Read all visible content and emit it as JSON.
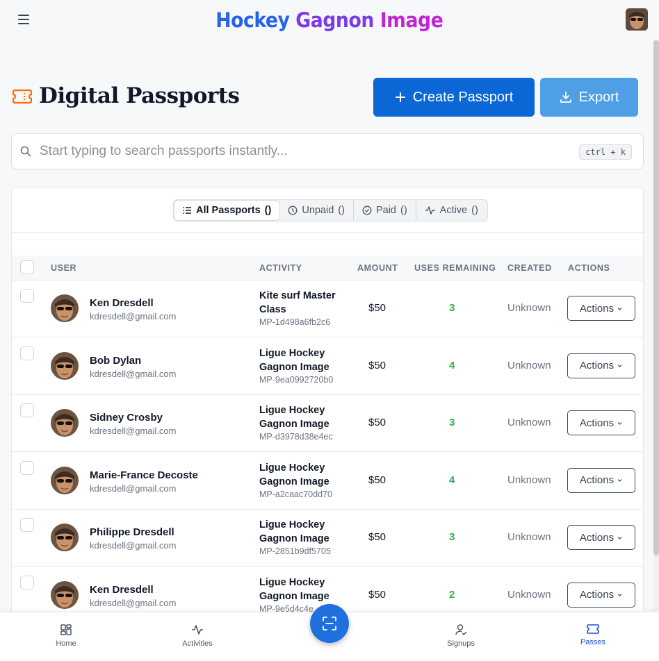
{
  "header": {
    "brand_part1": "Hockey",
    "brand_part2": "Gagnon",
    "brand_part3": "Image"
  },
  "page": {
    "title": "Digital Passports",
    "create_label": "Create Passport",
    "export_label": "Export"
  },
  "search": {
    "placeholder": "Start typing to search passports instantly...",
    "shortcut": "ctrl + k"
  },
  "tabs": [
    {
      "label": "All Passports",
      "count": "()"
    },
    {
      "label": "Unpaid",
      "count": "()"
    },
    {
      "label": "Paid",
      "count": "()"
    },
    {
      "label": "Active",
      "count": "()"
    }
  ],
  "table": {
    "columns": [
      "USER",
      "ACTIVITY",
      "AMOUNT",
      "USES REMAINING",
      "CREATED",
      "ACTIONS"
    ],
    "rows": [
      {
        "name": "Ken Dresdell",
        "email": "kdresdell@gmail.com",
        "activity": "Kite surf Master Class",
        "id": "MP-1d498a6fb2c6",
        "amount": "$50",
        "uses": "3",
        "created": "Unknown",
        "action": "Actions"
      },
      {
        "name": "Bob Dylan",
        "email": "kdresdell@gmail.com",
        "activity": "Ligue Hockey Gagnon Image",
        "id": "MP-9ea0992720b0",
        "amount": "$50",
        "uses": "4",
        "created": "Unknown",
        "action": "Actions"
      },
      {
        "name": "Sidney Crosby",
        "email": "kdresdell@gmail.com",
        "activity": "Ligue Hockey Gagnon Image",
        "id": "MP-d3978d38e4ec",
        "amount": "$50",
        "uses": "3",
        "created": "Unknown",
        "action": "Actions"
      },
      {
        "name": "Marie-France Decoste",
        "email": "kdresdell@gmail.com",
        "activity": "Ligue Hockey Gagnon Image",
        "id": "MP-a2caac70dd70",
        "amount": "$50",
        "uses": "4",
        "created": "Unknown",
        "action": "Actions"
      },
      {
        "name": "Philippe Dresdell",
        "email": "kdresdell@gmail.com",
        "activity": "Ligue Hockey Gagnon Image",
        "id": "MP-2851b9df5705",
        "amount": "$50",
        "uses": "3",
        "created": "Unknown",
        "action": "Actions"
      },
      {
        "name": "Ken Dresdell",
        "email": "kdresdell@gmail.com",
        "activity": "Ligue Hockey Gagnon Image",
        "id": "MP-9e5d4c4e",
        "amount": "$50",
        "uses": "2",
        "created": "Unknown",
        "action": "Actions"
      }
    ]
  },
  "bottom_nav": [
    {
      "label": "Home",
      "icon": "home-icon"
    },
    {
      "label": "Activities",
      "icon": "activity-icon"
    },
    {
      "label": "Signups",
      "icon": "user-check-icon"
    },
    {
      "label": "Passes",
      "icon": "ticket-icon"
    }
  ],
  "colors": {
    "primary": "#0b66d6",
    "export": "#4e9fe6",
    "uses_green": "#2eaf4d",
    "active_nav": "#1d4ed8",
    "brand_blue": "#2563eb",
    "brand_purple": "#7c3aed",
    "brand_magenta": "#c026d3",
    "ticket_orange": "#f97316"
  }
}
